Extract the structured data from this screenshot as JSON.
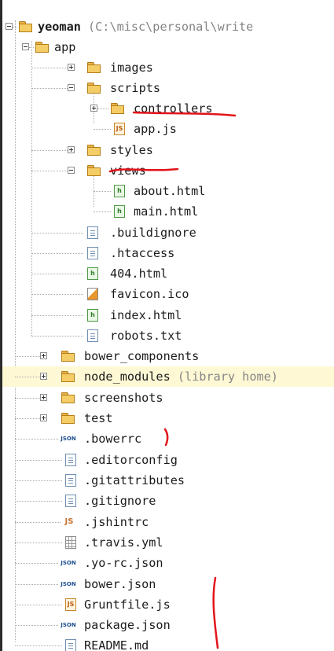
{
  "tree": {
    "root": {
      "label": "yeoman",
      "path_suffix": " (C:\\misc\\personal\\write"
    },
    "app": "app",
    "images": "images",
    "scripts": "scripts",
    "controllers": "controllers",
    "app_js": "app.js",
    "styles": "styles",
    "views": "views",
    "about_html": "about.html",
    "main_html": "main.html",
    "buildignore": ".buildignore",
    "htaccess": ".htaccess",
    "html_404": "404.html",
    "favicon": "favicon.ico",
    "index_html": "index.html",
    "robots": "robots.txt",
    "bower_components": "bower_components",
    "node_modules": {
      "label": "node_modules",
      "suffix": " (library home)"
    },
    "screenshots": "screenshots",
    "test": "test",
    "bowerrc": ".bowerrc",
    "editorconfig": ".editorconfig",
    "gitattributes": ".gitattributes",
    "gitignore": ".gitignore",
    "jshintrc": ".jshintrc",
    "travis": ".travis.yml",
    "yo_rc": ".yo-rc.json",
    "bower_json": "bower.json",
    "gruntfile": "Gruntfile.js",
    "package_json": "package.json",
    "readme": "README.md"
  },
  "icon_text": {
    "html": "h",
    "js": "JS",
    "json": "JSON"
  },
  "colors": {
    "annotation": "#e2141b",
    "selection": "#fff8d5",
    "folder": "#f5cd66"
  }
}
